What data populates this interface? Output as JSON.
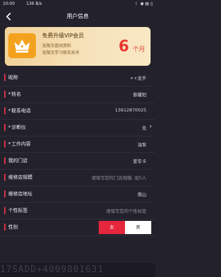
{
  "status_bar": {
    "time": "10:00",
    "network": "136 B/s",
    "right": "☾ ◉ ▤ ▯"
  },
  "nav": {
    "title": "用户信息",
    "back_icon": "chevron-left-icon"
  },
  "vip_card": {
    "title": "免费升级VIP会员",
    "line1": "无限次查阅资料",
    "line2": "无限次学习修车技术",
    "months_number": "6",
    "months_unit": "个月",
    "accent": "#e8382e",
    "crown_bg": "#f4a21e"
  },
  "form": {
    "rows": [
      {
        "label": "昵称",
        "required": false,
        "value": "++龙手",
        "placeholder": false,
        "chevron": false
      },
      {
        "label": "姓名",
        "required": true,
        "value": "蔡耀阳",
        "placeholder": false,
        "chevron": false
      },
      {
        "label": "联系电话",
        "required": true,
        "value": "13612870025",
        "placeholder": false,
        "chevron": false
      },
      {
        "label": "诊断仪",
        "required": true,
        "value": "无",
        "placeholder": false,
        "chevron": true
      },
      {
        "label": "工作内容",
        "required": true,
        "value": "油泵",
        "placeholder": false,
        "chevron": false
      },
      {
        "label": "我的门店",
        "required": false,
        "value": "爱车卡",
        "placeholder": false,
        "chevron": false
      },
      {
        "label": "维修店规模",
        "required": false,
        "value": "请填写您的门店规模, 如5人",
        "placeholder": true,
        "chevron": false
      },
      {
        "label": "维修店地址",
        "required": false,
        "value": "南山",
        "placeholder": false,
        "chevron": false
      },
      {
        "label": "个性标签",
        "required": false,
        "value": "请填写您的个性标签",
        "placeholder": true,
        "chevron": false
      }
    ],
    "gender": {
      "label": "性别",
      "options": [
        "女",
        "男"
      ],
      "selected": "女"
    }
  },
  "bottom_ghost_text": "17SADD+4009801631",
  "colors": {
    "background": "#23222c",
    "row_marker": "#d8324a",
    "gender_selected": "#e6263d"
  }
}
